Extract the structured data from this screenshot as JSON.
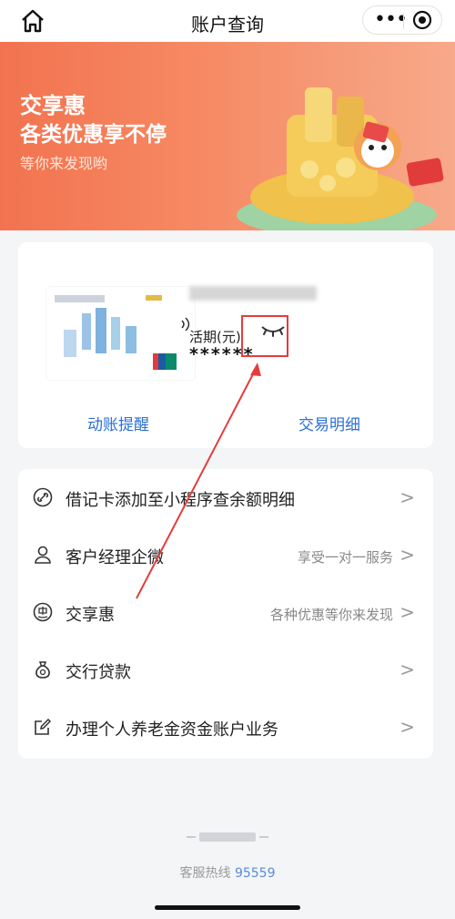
{
  "header": {
    "title": "账户查询"
  },
  "banner": {
    "title": "交享惠",
    "subtitle": "各类优惠享不停",
    "tagline": "等你来发现哟"
  },
  "account": {
    "card_brand": "UnionPay",
    "card_brand_cn": "银联",
    "type_label": "活期(元)",
    "balance": "******",
    "link_alerts": "动账提醒",
    "link_details": "交易明细"
  },
  "menu": [
    {
      "label": "借记卡添加至小程序查余额明细",
      "sub": "",
      "icon": "link-icon"
    },
    {
      "label": "客户经理企微",
      "sub": "享受一对一服务",
      "icon": "user-icon"
    },
    {
      "label": "交享惠",
      "sub": "各种优惠等你来发现",
      "icon": "hui-icon"
    },
    {
      "label": "交行贷款",
      "sub": "",
      "icon": "money-bag-icon"
    },
    {
      "label": "办理个人养老金资金账户业务",
      "sub": "",
      "icon": "edit-icon"
    }
  ],
  "footer": {
    "hotline_label": "客服热线",
    "hotline_number": "95559"
  },
  "colors": {
    "accent": "#2b6fd6",
    "banner": "#f2734f",
    "highlight": "#e53c3c"
  }
}
